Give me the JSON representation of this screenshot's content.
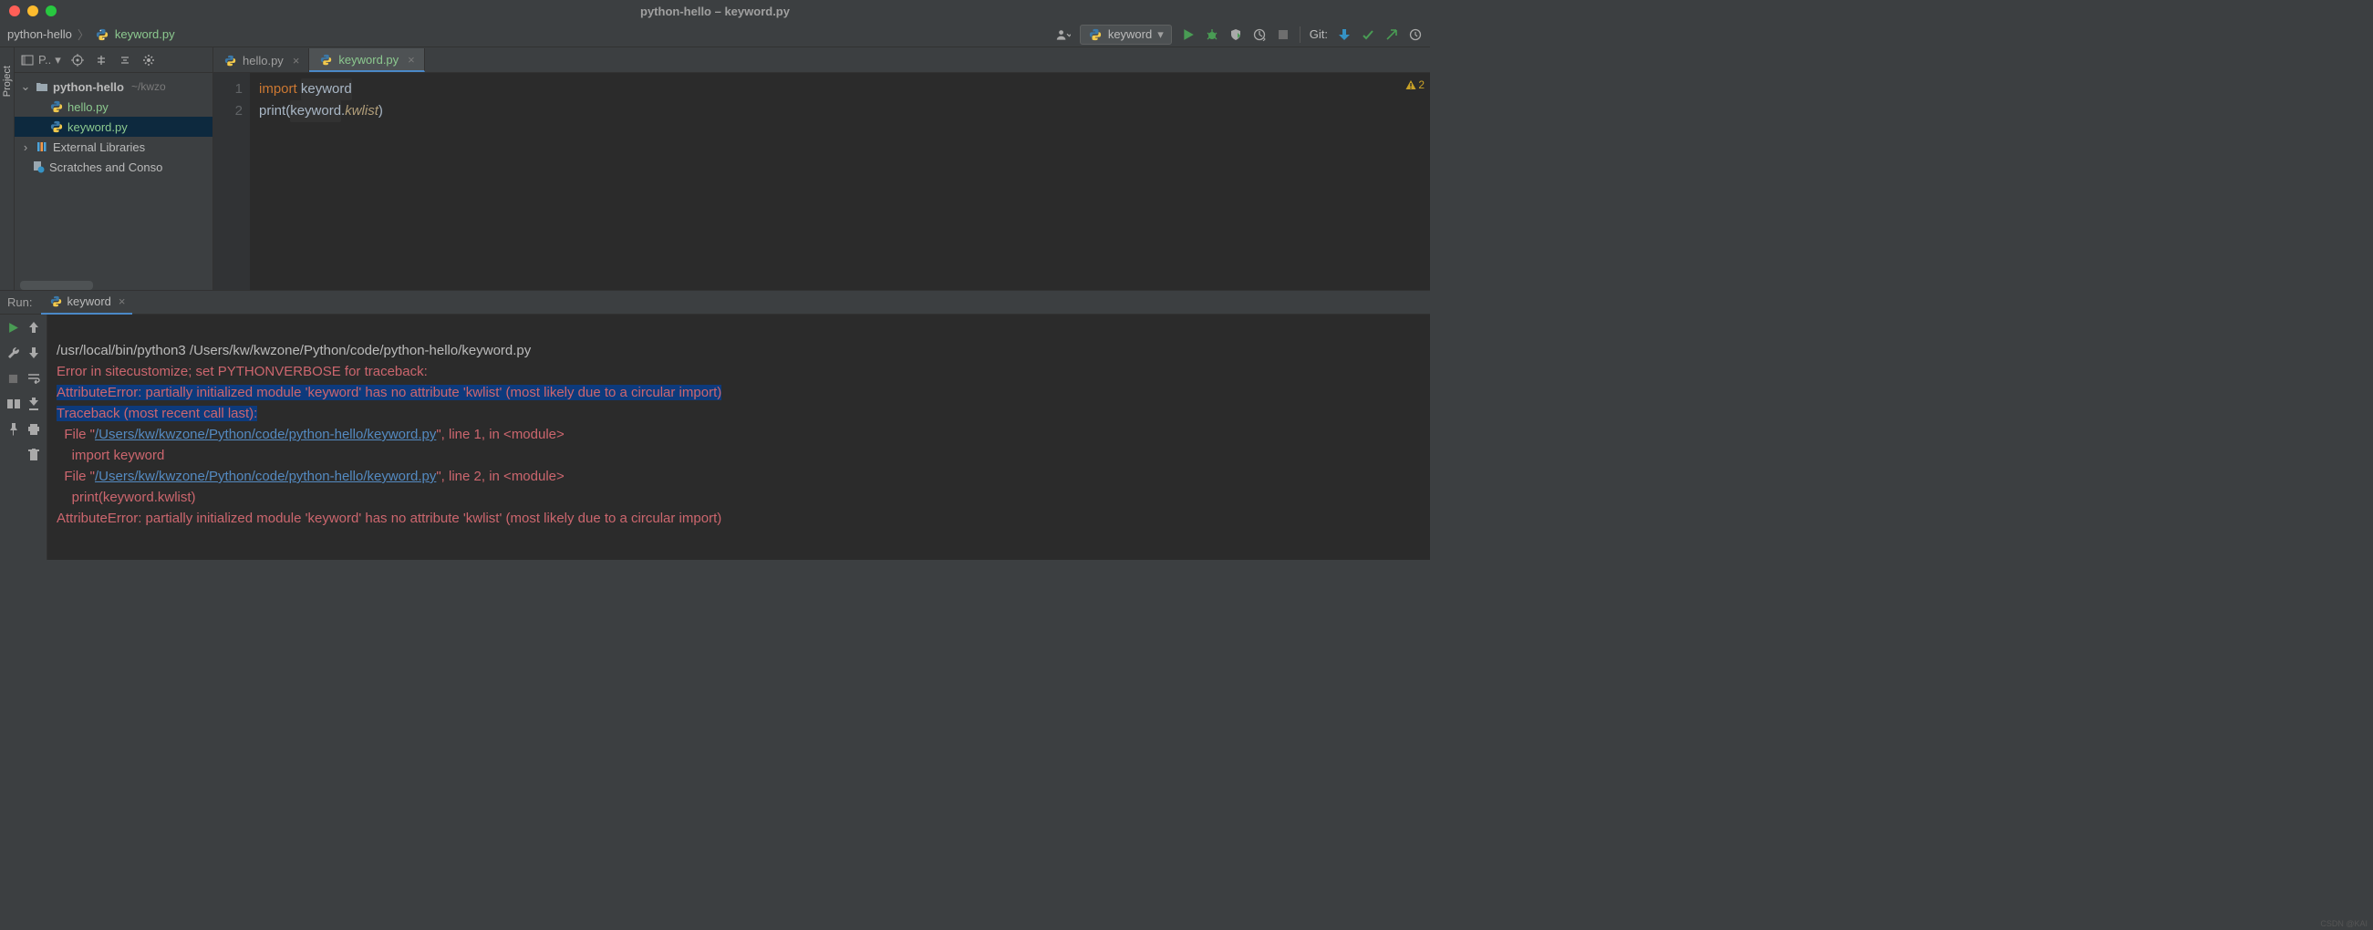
{
  "title": "python-hello – keyword.py",
  "breadcrumb": {
    "project": "python-hello",
    "file": "keyword.py"
  },
  "toolbar": {
    "run_config": "keyword",
    "git_label": "Git:"
  },
  "sidebar": {
    "head": "P..",
    "project": {
      "name": "python-hello",
      "path": "~/kwzo"
    },
    "files": [
      "hello.py",
      "keyword.py"
    ],
    "external": "External Libraries",
    "scratches": "Scratches and Conso"
  },
  "tabs": [
    {
      "label": "hello.py",
      "active": false
    },
    {
      "label": "keyword.py",
      "active": true
    }
  ],
  "editor": {
    "lines": [
      "1",
      "2"
    ],
    "l1_kw": "import",
    "l1_id": "keyword",
    "l2_fn": "print",
    "l2_p1": "(",
    "l2_id": "keyword",
    "l2_dot": ".",
    "l2_attr": "kwlist",
    "l2_p2": ")",
    "warn_count": "2"
  },
  "run": {
    "label": "Run:",
    "tab": "keyword",
    "output": {
      "cmd": "/usr/local/bin/python3 /Users/kw/kwzone/Python/code/python-hello/keyword.py",
      "err1": "Error in sitecustomize; set PYTHONVERBOSE for traceback:",
      "err2": "AttributeError: partially initialized module 'keyword' has no attribute 'kwlist' (most likely due to a circular import)",
      "tb": "Traceback (most recent call last):",
      "f1a": "  File \"",
      "f1link": "/Users/kw/kwzone/Python/code/python-hello/keyword.py",
      "f1b": "\", line 1, in <module>",
      "f1src": "    import keyword",
      "f2a": "  File \"",
      "f2link": "/Users/kw/kwzone/Python/code/python-hello/keyword.py",
      "f2b": "\", line 2, in <module>",
      "f2src": "    print(keyword.kwlist)",
      "err3": "AttributeError: partially initialized module 'keyword' has no attribute 'kwlist' (most likely due to a circular import)"
    }
  },
  "watermark": "CSDN @KAI"
}
